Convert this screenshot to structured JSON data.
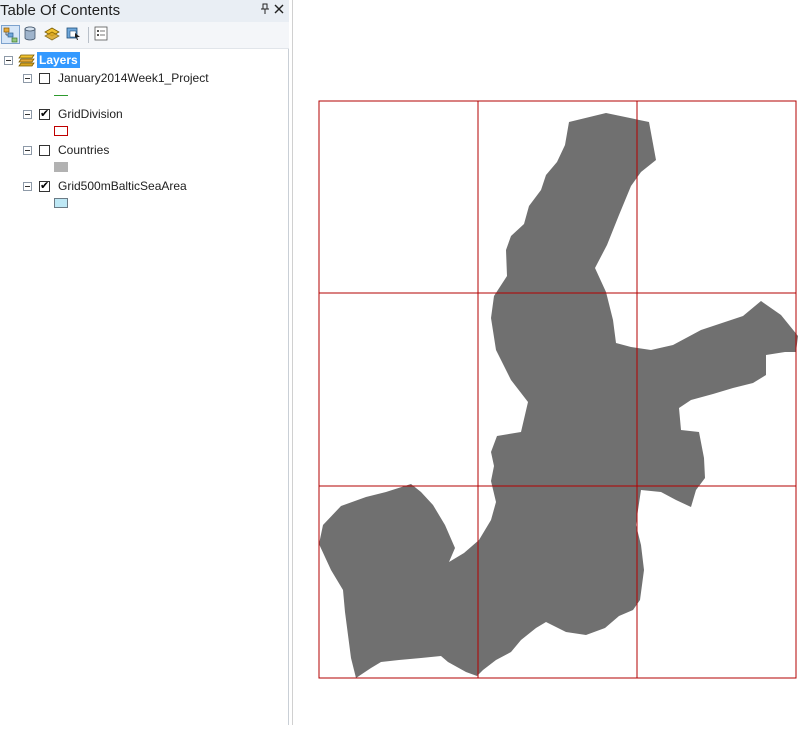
{
  "toc": {
    "title": "Table Of Contents",
    "pin_glyph": "📌",
    "close_glyph": "✕",
    "toolbar": {
      "tools": [
        {
          "name": "list-by-drawing-order",
          "active": true
        },
        {
          "name": "list-by-source",
          "active": false
        },
        {
          "name": "list-by-visibility",
          "active": false
        },
        {
          "name": "list-by-selection",
          "active": false
        },
        {
          "name": "options",
          "active": false
        }
      ]
    },
    "root_label": "Layers",
    "layers": [
      {
        "name": "January2014Week1_Project",
        "checked": false,
        "symbol": "line",
        "color": "#2e9a2e"
      },
      {
        "name": "GridDivision",
        "checked": true,
        "symbol": "hollow-rect",
        "color": "#c00000"
      },
      {
        "name": "Countries",
        "checked": false,
        "symbol": "fill",
        "color": "#b2b2b2"
      },
      {
        "name": "Grid500mBalticSeaArea",
        "checked": true,
        "symbol": "fill-outline",
        "color": "#bee8f5"
      }
    ]
  },
  "map": {
    "grid_color": "#b30000",
    "polygon_fill": "#707070",
    "grid": {
      "rows": 3,
      "cols": 3
    }
  }
}
